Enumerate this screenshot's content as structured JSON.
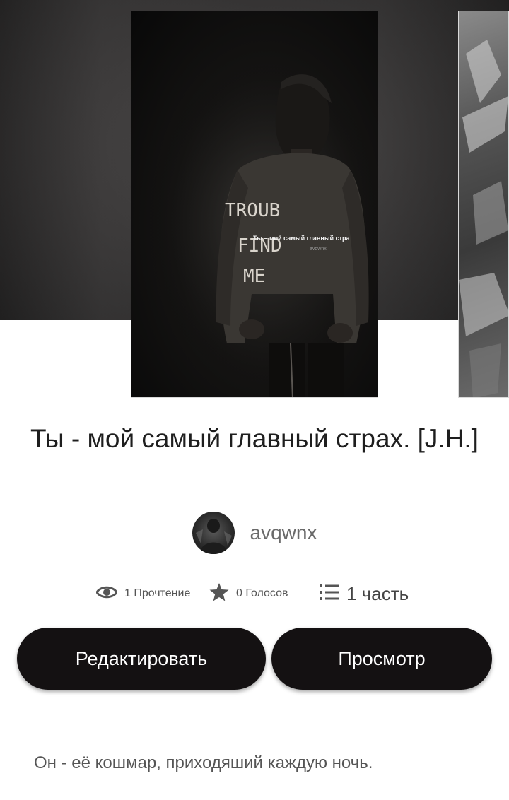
{
  "cover": {
    "overlay_title": "Ты – мой самый главный стра",
    "overlay_author": "avqwnx",
    "shirt_text": [
      "TROUB",
      "FIND",
      "ME"
    ]
  },
  "story": {
    "title": "Ты - мой самый главный страх. [J.H.]",
    "author": "avqwnx",
    "description": "Он - её кошмар, приходяший каждую ночь."
  },
  "stats": {
    "reads": "1 Прочтение",
    "votes": "0 Голосов",
    "parts": "1 часть"
  },
  "buttons": {
    "edit": "Редактировать",
    "preview": "Просмотр"
  },
  "icons": {
    "reads": "eye-icon",
    "votes": "star-icon",
    "parts": "list-icon"
  }
}
